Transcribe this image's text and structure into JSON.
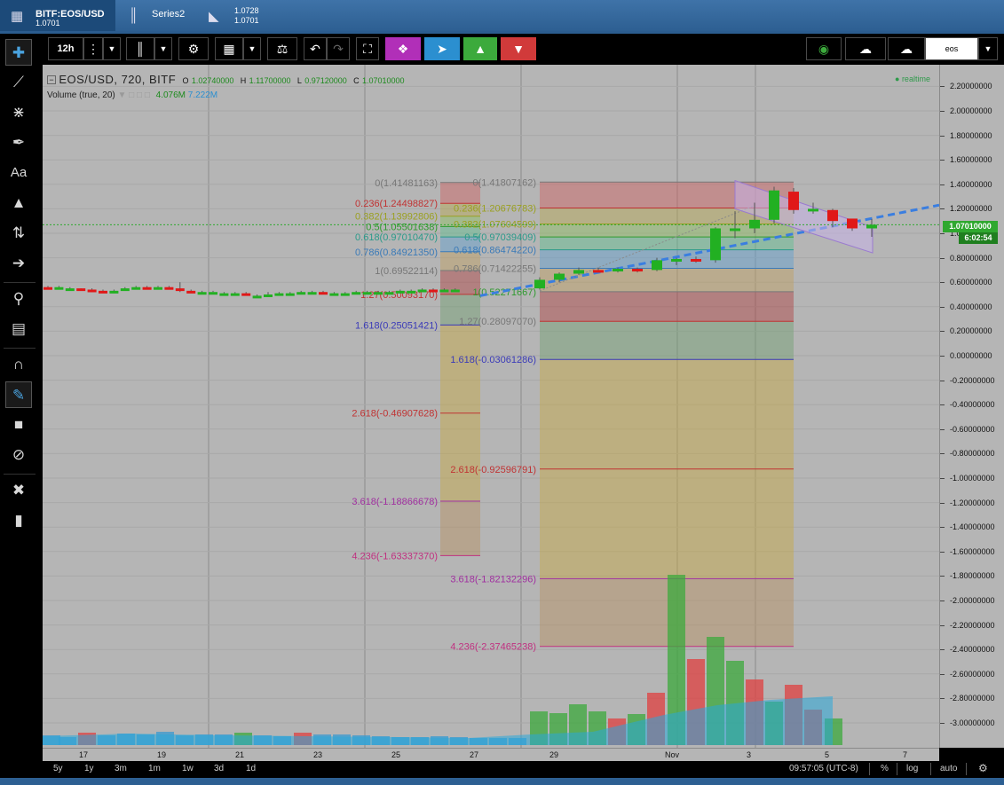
{
  "tabs": [
    {
      "title": "BITF:EOS/USD",
      "sub": "1.0701"
    },
    {
      "title": "Series2",
      "sub": ""
    },
    {
      "title": "1.0728",
      "sub": "1.0701"
    }
  ],
  "toolbar": {
    "interval": "12h",
    "symbol_field": "eos"
  },
  "legend": {
    "symbol": "EOS/USD, 720, BITF",
    "o_label": "O",
    "o": "1.02740000",
    "h_label": "H",
    "h": "1.11700000",
    "l_label": "L",
    "l": "0.97120000",
    "c_label": "C",
    "c": "1.07010000",
    "volume_label": "Volume (true, 20)",
    "volume_1": "4.076M",
    "volume_2": "7.222M",
    "realtime": "realtime"
  },
  "price_axis": {
    "labels": [
      "2.20000000",
      "2.00000000",
      "1.80000000",
      "1.60000000",
      "1.40000000",
      "1.20000000",
      "1.00000000",
      "0.80000000",
      "0.60000000",
      "0.40000000",
      "0.20000000",
      "0.00000000",
      "-0.20000000",
      "-0.40000000",
      "-0.60000000",
      "-0.80000000",
      "-1.00000000",
      "-1.20000000",
      "-1.40000000",
      "-1.60000000",
      "-1.80000000",
      "-2.00000000",
      "-2.20000000",
      "-2.40000000",
      "-2.60000000",
      "-2.80000000",
      "-3.00000000"
    ],
    "last_price": "1.07010000",
    "countdown": "6:02:54"
  },
  "time_axis": [
    "17",
    "19",
    "21",
    "23",
    "25",
    "27",
    "29",
    "Nov",
    "3",
    "5",
    "7"
  ],
  "fib_left": [
    {
      "text": "0(1.41481163)",
      "color": "#777777"
    },
    {
      "text": "0.236(1.24498827)",
      "color": "#c03333"
    },
    {
      "text": "0.382(1.13992806)",
      "color": "#9aa020"
    },
    {
      "text": "0.5(1.05501638)",
      "color": "#2e9a2e"
    },
    {
      "text": "0.618(0.97010470)",
      "color": "#2a9a8a"
    },
    {
      "text": "0.786(0.84921350)",
      "color": "#3a7ab8"
    },
    {
      "text": "1(0.69522114)",
      "color": "#777777"
    },
    {
      "text": "1.27(0.50093170)",
      "color": "#c03333"
    },
    {
      "text": "1.618(0.25051421)",
      "color": "#3a3ab8"
    },
    {
      "text": "2.618(-0.46907628)",
      "color": "#c03333"
    },
    {
      "text": "3.618(-1.18866678)",
      "color": "#a030a0"
    },
    {
      "text": "4.236(-1.63337370)",
      "color": "#c03080"
    }
  ],
  "fib_right": [
    {
      "text": "0(1.41807162)",
      "color": "#777777"
    },
    {
      "text": "0.236(1.20676783)",
      "color": "#9aa020"
    },
    {
      "text": "0.382(1.07604599)",
      "color": "#9aa020"
    },
    {
      "text": "0.5(0.97039409)",
      "color": "#2a9a8a"
    },
    {
      "text": "0.618(0.86474220)",
      "color": "#3a7ab8"
    },
    {
      "text": "0.786(0.71422255)",
      "color": "#777777"
    },
    {
      "text": "1(0.52271667)",
      "color": "#2e9a2e"
    },
    {
      "text": "1.27(0.28097070)",
      "color": "#777777"
    },
    {
      "text": "1.618(-0.03061286)",
      "color": "#3a3ab8"
    },
    {
      "text": "2.618(-0.92596791)",
      "color": "#c03333"
    },
    {
      "text": "3.618(-1.82132296)",
      "color": "#a030a0"
    },
    {
      "text": "4.236(-2.37465238)",
      "color": "#c03080"
    }
  ],
  "bottom": {
    "ranges": [
      "5y",
      "1y",
      "3m",
      "1m",
      "1w",
      "3d",
      "1d"
    ],
    "clock": "09:57:05 (UTC-8)",
    "pct": "%",
    "log": "log",
    "auto": "auto"
  },
  "colors": {
    "up": "#22b022",
    "down": "#e01818",
    "chart_bg": "#b5b5b5",
    "trend": "#3a7ee0"
  },
  "chart_data": {
    "type": "candlestick",
    "title": "EOS/USD, 720, BITF",
    "ylim": [
      -3.1,
      2.25
    ],
    "x_ticks": [
      "17",
      "19",
      "21",
      "23",
      "25",
      "27",
      "29",
      "Nov",
      "3",
      "5",
      "7"
    ],
    "candles": [
      {
        "o": 0.56,
        "c": 0.55,
        "h": 0.57,
        "l": 0.55
      },
      {
        "o": 0.55,
        "c": 0.56,
        "h": 0.57,
        "l": 0.55
      },
      {
        "o": 0.55,
        "c": 0.55,
        "h": 0.56,
        "l": 0.54
      },
      {
        "o": 0.55,
        "c": 0.54,
        "h": 0.55,
        "l": 0.53
      },
      {
        "o": 0.54,
        "c": 0.53,
        "h": 0.55,
        "l": 0.52
      },
      {
        "o": 0.53,
        "c": 0.52,
        "h": 0.54,
        "l": 0.52
      },
      {
        "o": 0.52,
        "c": 0.53,
        "h": 0.54,
        "l": 0.51
      },
      {
        "o": 0.54,
        "c": 0.55,
        "h": 0.56,
        "l": 0.53
      },
      {
        "o": 0.55,
        "c": 0.56,
        "h": 0.57,
        "l": 0.54
      },
      {
        "o": 0.56,
        "c": 0.55,
        "h": 0.57,
        "l": 0.55
      },
      {
        "o": 0.55,
        "c": 0.56,
        "h": 0.57,
        "l": 0.55
      },
      {
        "o": 0.56,
        "c": 0.55,
        "h": 0.57,
        "l": 0.55
      },
      {
        "o": 0.55,
        "c": 0.53,
        "h": 0.6,
        "l": 0.52
      },
      {
        "o": 0.53,
        "c": 0.52,
        "h": 0.54,
        "l": 0.51
      },
      {
        "o": 0.52,
        "c": 0.52,
        "h": 0.53,
        "l": 0.51
      },
      {
        "o": 0.52,
        "c": 0.52,
        "h": 0.53,
        "l": 0.52
      },
      {
        "o": 0.51,
        "c": 0.51,
        "h": 0.52,
        "l": 0.5
      },
      {
        "o": 0.51,
        "c": 0.51,
        "h": 0.52,
        "l": 0.5
      },
      {
        "o": 0.51,
        "c": 0.5,
        "h": 0.52,
        "l": 0.49
      },
      {
        "o": 0.49,
        "c": 0.49,
        "h": 0.5,
        "l": 0.48
      },
      {
        "o": 0.49,
        "c": 0.5,
        "h": 0.52,
        "l": 0.48
      },
      {
        "o": 0.5,
        "c": 0.51,
        "h": 0.52,
        "l": 0.49
      },
      {
        "o": 0.5,
        "c": 0.51,
        "h": 0.52,
        "l": 0.49
      },
      {
        "o": 0.51,
        "c": 0.52,
        "h": 0.53,
        "l": 0.5
      },
      {
        "o": 0.51,
        "c": 0.52,
        "h": 0.53,
        "l": 0.5
      },
      {
        "o": 0.52,
        "c": 0.51,
        "h": 0.53,
        "l": 0.51
      },
      {
        "o": 0.51,
        "c": 0.51,
        "h": 0.52,
        "l": 0.5
      },
      {
        "o": 0.51,
        "c": 0.51,
        "h": 0.52,
        "l": 0.5
      },
      {
        "o": 0.51,
        "c": 0.52,
        "h": 0.53,
        "l": 0.5
      },
      {
        "o": 0.52,
        "c": 0.52,
        "h": 0.53,
        "l": 0.51
      },
      {
        "o": 0.52,
        "c": 0.52,
        "h": 0.53,
        "l": 0.51
      },
      {
        "o": 0.52,
        "c": 0.52,
        "h": 0.53,
        "l": 0.51
      },
      {
        "o": 0.52,
        "c": 0.53,
        "h": 0.54,
        "l": 0.51
      },
      {
        "o": 0.53,
        "c": 0.53,
        "h": 0.54,
        "l": 0.52
      },
      {
        "o": 0.53,
        "c": 0.54,
        "h": 0.55,
        "l": 0.52
      },
      {
        "o": 0.54,
        "c": 0.53,
        "h": 0.55,
        "l": 0.52
      },
      {
        "o": 0.53,
        "c": 0.54,
        "h": 0.55,
        "l": 0.52
      },
      {
        "o": 0.54,
        "c": 0.54,
        "h": 0.55,
        "l": 0.53
      },
      {
        "o": 0.55,
        "c": 0.62,
        "h": 0.64,
        "l": 0.54
      },
      {
        "o": 0.62,
        "c": 0.67,
        "h": 0.68,
        "l": 0.6
      },
      {
        "o": 0.67,
        "c": 0.7,
        "h": 0.72,
        "l": 0.66
      },
      {
        "o": 0.7,
        "c": 0.69,
        "h": 0.72,
        "l": 0.68
      },
      {
        "o": 0.69,
        "c": 0.71,
        "h": 0.72,
        "l": 0.68
      },
      {
        "o": 0.71,
        "c": 0.7,
        "h": 0.72,
        "l": 0.68
      },
      {
        "o": 0.7,
        "c": 0.78,
        "h": 0.8,
        "l": 0.69
      },
      {
        "o": 0.78,
        "c": 0.79,
        "h": 0.8,
        "l": 0.74
      },
      {
        "o": 0.79,
        "c": 0.78,
        "h": 0.81,
        "l": 0.76
      },
      {
        "o": 0.78,
        "c": 1.04,
        "h": 1.05,
        "l": 0.76
      },
      {
        "o": 1.04,
        "c": 1.04,
        "h": 1.18,
        "l": 0.96
      },
      {
        "o": 1.04,
        "c": 1.11,
        "h": 1.25,
        "l": 1.0
      },
      {
        "o": 1.11,
        "c": 1.35,
        "h": 1.38,
        "l": 1.08
      },
      {
        "o": 1.34,
        "c": 1.19,
        "h": 1.37,
        "l": 1.16
      },
      {
        "o": 1.19,
        "c": 1.2,
        "h": 1.25,
        "l": 1.16
      },
      {
        "o": 1.19,
        "c": 1.1,
        "h": 1.2,
        "l": 1.05
      },
      {
        "o": 1.12,
        "c": 1.04,
        "h": 1.12,
        "l": 1.02
      },
      {
        "o": 1.04,
        "c": 1.07,
        "h": 1.117,
        "l": 0.971
      }
    ]
  }
}
